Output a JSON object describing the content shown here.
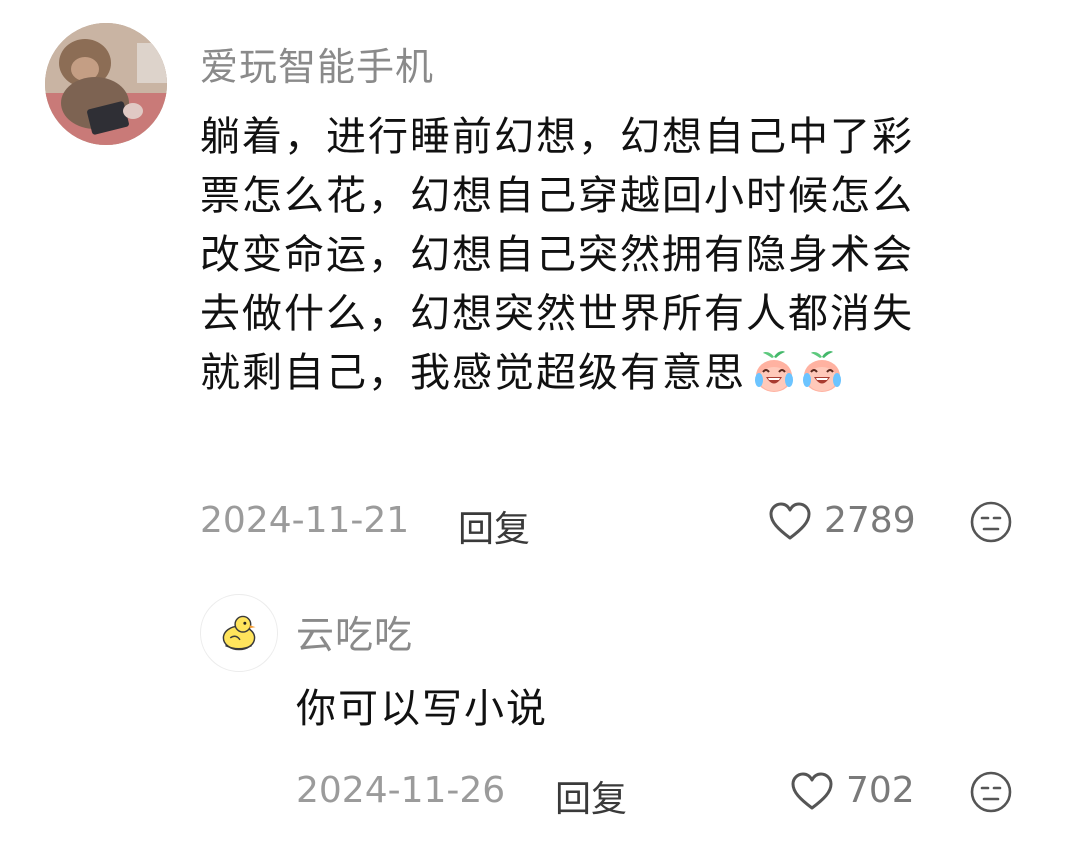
{
  "comment": {
    "username": "爱玩智能手机",
    "avatar_icon": "monkey-photo",
    "text_lines": [
      "躺着，进行睡前幻想，幻想自己中了彩",
      "票怎么花，幻想自己穿越回小时候怎么",
      "改变命运，幻想自己突然拥有隐身术会",
      "去做什么，幻想突然世界所有人都消失",
      "就剩自己，我感觉超级有意思"
    ],
    "emojis": [
      "crying-laughing-peach-emoji",
      "crying-laughing-peach-emoji"
    ],
    "date": "2024-11-21",
    "reply_label": "回复",
    "likes": "2789",
    "like_icon": "heart-outline-icon",
    "reaction_icon": "neutral-face-icon"
  },
  "reply": {
    "username": "云吃吃",
    "avatar_icon": "yellow-chick-avatar",
    "text": "你可以写小说",
    "date": "2024-11-26",
    "reply_label": "回复",
    "likes": "702",
    "like_icon": "heart-outline-icon",
    "reaction_icon": "neutral-face-icon"
  }
}
